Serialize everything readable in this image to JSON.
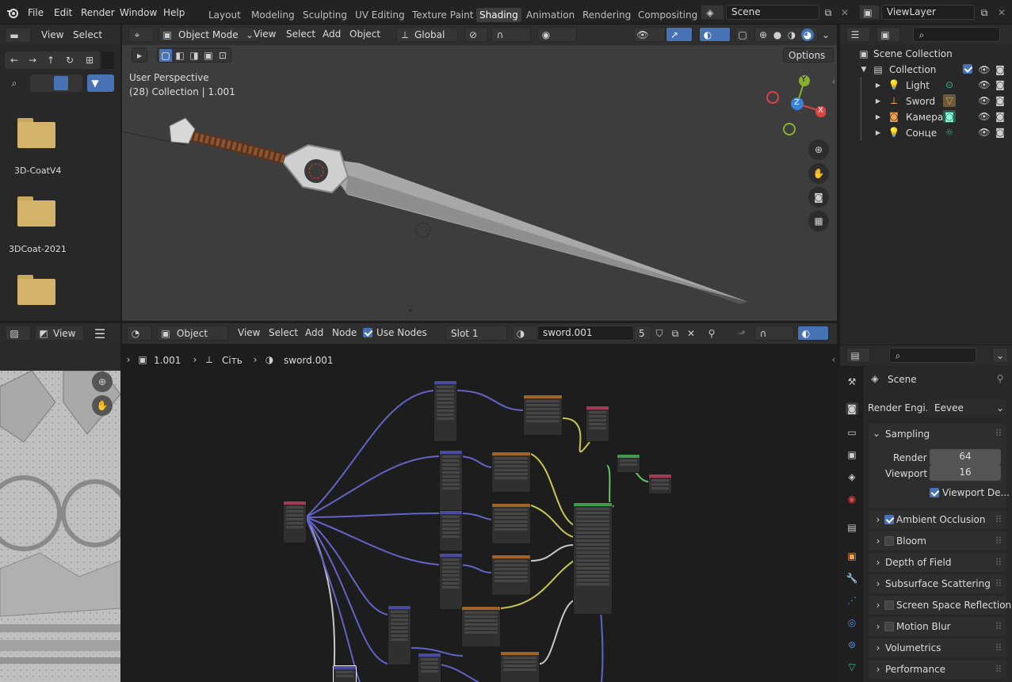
{
  "topbar": {
    "menus": [
      "File",
      "Edit",
      "Render",
      "Window",
      "Help"
    ],
    "workspaces": [
      "Layout",
      "Modeling",
      "Sculpting",
      "UV Editing",
      "Texture Paint",
      "Shading",
      "Animation",
      "Rendering",
      "Compositing"
    ],
    "active_workspace": "Shading",
    "scene": "Scene",
    "view_layer": "ViewLayer"
  },
  "file_browser": {
    "view_label": "View",
    "select_label": "Select",
    "folders": [
      "3D-CoatV4",
      "3DCoat-2021",
      ""
    ]
  },
  "viewport": {
    "mode": "Object Mode",
    "menus": [
      "View",
      "Select",
      "Add",
      "Object"
    ],
    "transform": "Global",
    "options_label": "Options",
    "perspective": "User Perspective",
    "collection_info": "(28) Collection | 1.001",
    "gizmo": {
      "y": "Y",
      "z": "Z",
      "x": "X"
    }
  },
  "outliner": {
    "scene_collection": "Scene Collection",
    "collection": "Collection",
    "items": [
      {
        "label": "Light",
        "icon": "light-icon"
      },
      {
        "label": "Sword",
        "icon": "mesh-icon"
      },
      {
        "label": "Камера",
        "icon": "camera-icon"
      },
      {
        "label": "Сонце",
        "icon": "sun-icon"
      }
    ]
  },
  "image_editor": {
    "view_label": "View"
  },
  "node_editor": {
    "object_label": "Object",
    "menus": [
      "View",
      "Select",
      "Add",
      "Node"
    ],
    "use_nodes_label": "Use Nodes",
    "use_nodes": true,
    "slot": "Slot 1",
    "material": "sword.001",
    "users": "5",
    "breadcrumb": [
      "1.001",
      "Сіть",
      "sword.001"
    ]
  },
  "properties": {
    "scene_label": "Scene",
    "render_engine_label": "Render Engi...",
    "render_engine": "Eevee",
    "sampling_label": "Sampling",
    "render_label": "Render",
    "render_value": "64",
    "viewport_label": "Viewport",
    "viewport_value": "16",
    "viewport_denoise": "Viewport De...",
    "panels": [
      {
        "label": "Ambient Occlusion",
        "checkbox": true,
        "checked": true
      },
      {
        "label": "Bloom",
        "checkbox": true,
        "checked": false
      },
      {
        "label": "Depth of Field",
        "checkbox": false,
        "checked": false
      },
      {
        "label": "Subsurface Scattering",
        "checkbox": false,
        "checked": false
      },
      {
        "label": "Screen Space Reflections",
        "checkbox": true,
        "checked": false
      },
      {
        "label": "Motion Blur",
        "checkbox": true,
        "checked": false
      },
      {
        "label": "Volumetrics",
        "checkbox": false,
        "checked": false
      },
      {
        "label": "Performance",
        "checkbox": false,
        "checked": false
      }
    ]
  },
  "colors": {
    "accent": "#4772b3",
    "header": "#2b2b2b",
    "viewport_bg": "#3d3d3d",
    "node_bg": "#1d1d1d",
    "folder": "#d4b46a"
  }
}
